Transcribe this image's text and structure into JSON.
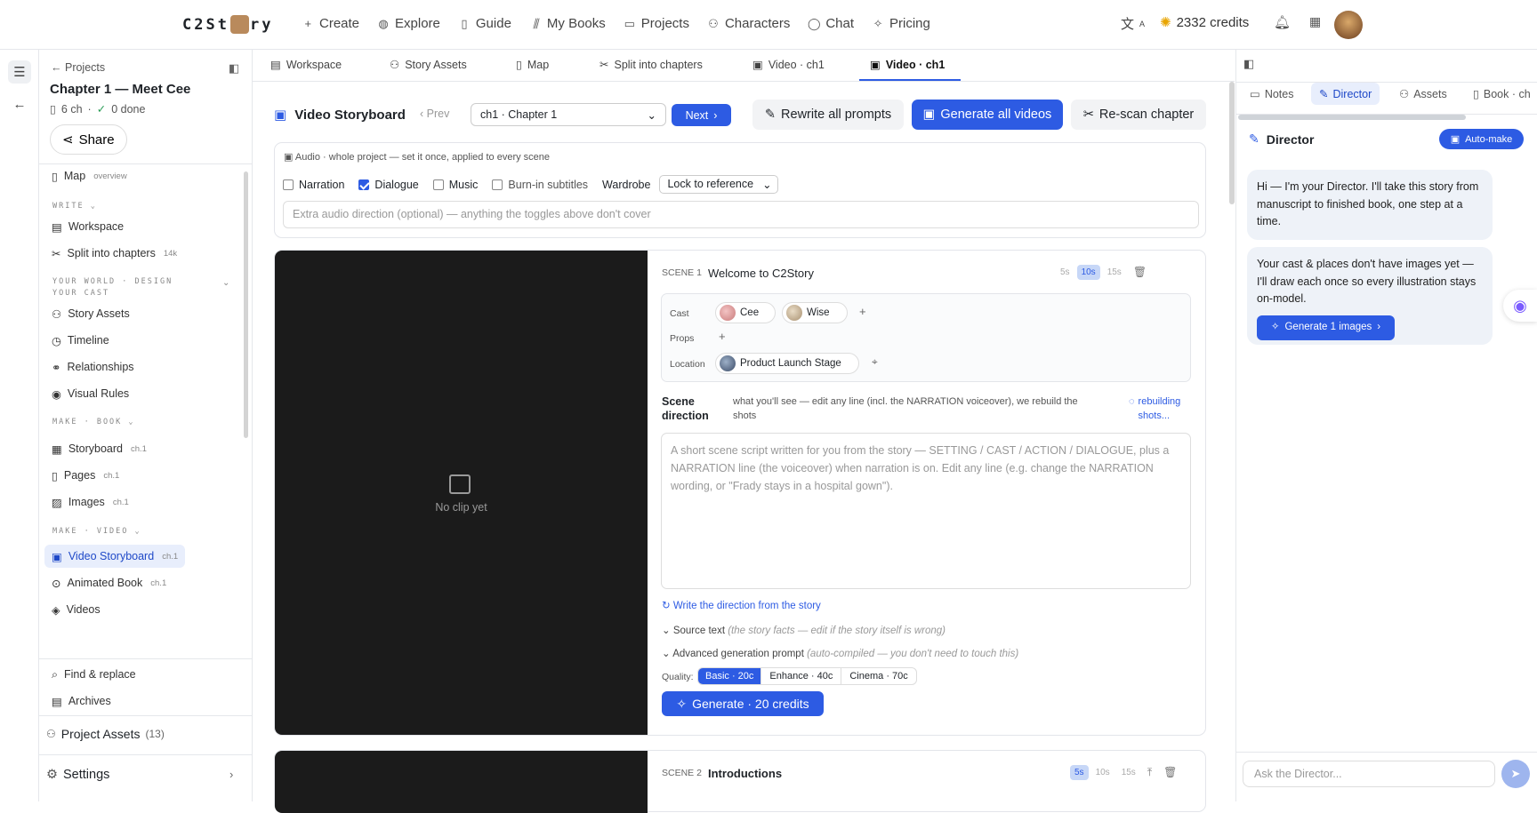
{
  "app": {
    "logo_text": "C2Story"
  },
  "nav": {
    "items": [
      {
        "label": "Create",
        "icon": "plus-icon"
      },
      {
        "label": "Explore",
        "icon": "globe-icon"
      },
      {
        "label": "Guide",
        "icon": "book-icon"
      },
      {
        "label": "My Books",
        "icon": "library-icon"
      },
      {
        "label": "Projects",
        "icon": "folder-icon"
      },
      {
        "label": "Characters",
        "icon": "users-icon"
      },
      {
        "label": "Chat",
        "icon": "chat-icon"
      },
      {
        "label": "Pricing",
        "icon": "sparkle-icon"
      }
    ]
  },
  "header": {
    "credits": "2332 credits"
  },
  "sidebar": {
    "back_label": "Projects",
    "chapter_title": "Chapter 1 — Meet Cee",
    "chapter_count": "6 ch",
    "done_count": "0 done",
    "share_label": "Share",
    "map": {
      "label": "Map",
      "badge": "overview"
    },
    "sections": {
      "write": "WRITE",
      "world": "YOUR WORLD · DESIGN YOUR CAST",
      "book": "MAKE · BOOK",
      "video": "MAKE · VIDEO"
    },
    "items": [
      {
        "label": "Workspace",
        "badge": ""
      },
      {
        "label": "Split into chapters",
        "badge": "14k"
      },
      {
        "label": "Story Assets",
        "badge": ""
      },
      {
        "label": "Timeline",
        "badge": ""
      },
      {
        "label": "Relationships",
        "badge": ""
      },
      {
        "label": "Visual Rules",
        "badge": ""
      },
      {
        "label": "Storyboard",
        "badge": "ch.1"
      },
      {
        "label": "Pages",
        "badge": "ch.1"
      },
      {
        "label": "Images",
        "badge": "ch.1"
      },
      {
        "label": "Video Storyboard",
        "badge": "ch.1"
      },
      {
        "label": "Animated Book",
        "badge": "ch.1"
      },
      {
        "label": "Videos",
        "badge": ""
      }
    ],
    "find_replace": "Find & replace",
    "archives": "Archives",
    "project_assets": "Project Assets",
    "project_assets_count": "(13)",
    "settings": "Settings"
  },
  "tabs": [
    {
      "label": "Workspace"
    },
    {
      "label": "Story Assets"
    },
    {
      "label": "Map"
    },
    {
      "label": "Split into chapters"
    },
    {
      "label": "Video · ch1"
    },
    {
      "label": "Video · ch1"
    }
  ],
  "toolbar": {
    "title": "Video Storyboard",
    "prev": "Prev",
    "chapter_select": "ch1 · Chapter 1",
    "next": "Next",
    "rewrite": "Rewrite all prompts",
    "generate_all": "Generate all videos",
    "rescan": "Re-scan chapter"
  },
  "audio": {
    "heading": "Audio · whole project — set it once, applied to every scene",
    "narration": "Narration",
    "dialogue": "Dialogue",
    "music": "Music",
    "burnin": "Burn-in subtitles",
    "wardrobe_label": "Wardrobe",
    "wardrobe_value": "Lock to reference",
    "extra_placeholder": "Extra audio direction (optional) — anything the toggles above don't cover",
    "narration_on": false,
    "dialogue_on": true,
    "music_on": false,
    "burnin_on": false
  },
  "scene1": {
    "number": "SCENE 1",
    "title": "Welcome to C2Story",
    "durations": [
      "5s",
      "10s",
      "15s"
    ],
    "selected_duration": "10s",
    "no_clip": "No clip yet",
    "cast_label": "Cast",
    "cast": [
      "Cee",
      "Wise"
    ],
    "props_label": "Props",
    "location_label": "Location",
    "location": "Product Launch Stage",
    "direction_label": "Scene direction",
    "direction_hint": "what you'll see — edit any line (incl. the NARRATION voiceover), we rebuild the shots",
    "rebuilding": "rebuilding shots...",
    "script_placeholder": "A short scene script written for you from the story — SETTING / CAST / ACTION / DIALOGUE, plus a NARRATION line (the voiceover) when narration is on. Edit any line (e.g. change the NARRATION wording, or \"Frady stays in a hospital gown\").",
    "write_direction": "Write the direction from the story",
    "source_text": "Source text",
    "source_hint": "(the story facts — edit if the story itself is wrong)",
    "advanced": "Advanced generation prompt",
    "advanced_hint": "(auto-compiled — you don't need to touch this)",
    "quality_label": "Quality:",
    "quality_options": [
      "Basic · 20c",
      "Enhance · 40c",
      "Cinema · 70c"
    ],
    "generate": "Generate · 20 credits"
  },
  "scene2": {
    "number": "SCENE 2",
    "title": "Introductions",
    "durations": [
      "5s",
      "10s",
      "15s"
    ],
    "selected_duration": "5s"
  },
  "right_panel": {
    "tabs": [
      "Notes",
      "Director",
      "Assets",
      "Book · ch"
    ],
    "title": "Director",
    "auto_make": "Auto-make",
    "message1": "Hi — I'm your Director. I'll take this story from manuscript to finished book, one step at a time.",
    "message2": "Your cast & places don't have images yet — I'll draw each once so every illustration stays on-model.",
    "generate_images": "Generate 1 images",
    "input_placeholder": "Ask the Director..."
  },
  "colors": {
    "accent": "#2d5be3",
    "accent_light": "#e8eefc",
    "video_bg": "#1b1b1b"
  }
}
